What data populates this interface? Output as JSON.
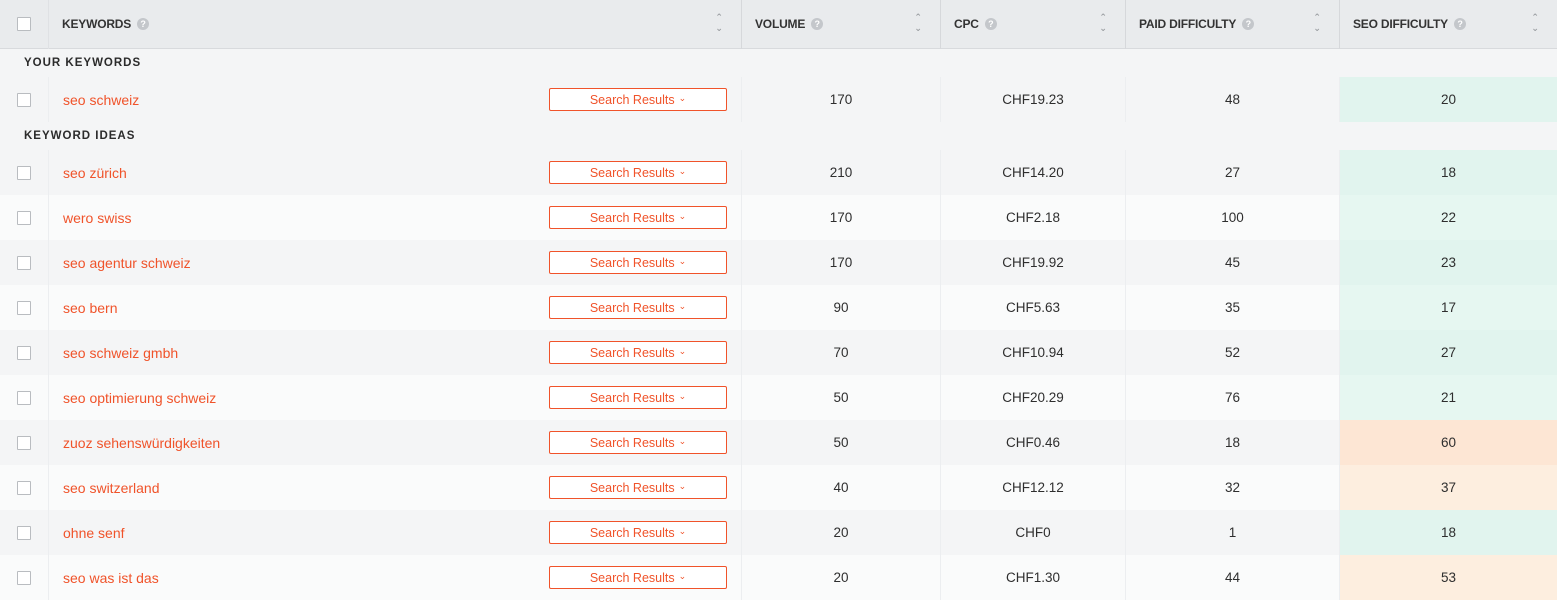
{
  "header": {
    "keywords": "KEYWORDS",
    "volume": "VOLUME",
    "cpc": "CPC",
    "paid_difficulty": "PAID DIFFICULTY",
    "seo_difficulty": "SEO DIFFICULTY",
    "help_glyph": "?",
    "sort_up": "⌃",
    "sort_down": "⌄"
  },
  "sections": {
    "your_keywords": "YOUR KEYWORDS",
    "keyword_ideas": "KEYWORD IDEAS"
  },
  "button_label": "Search Results",
  "colors": {
    "accent": "#f0532a",
    "seo_easy": "#e1f4ee",
    "seo_medium": "#fde6d4"
  },
  "your_keywords": [
    {
      "keyword": "seo schweiz",
      "volume": "170",
      "cpc": "CHF19.23",
      "paid": "48",
      "seo": "20",
      "seo_level": "easy"
    }
  ],
  "keyword_ideas": [
    {
      "keyword": "seo zürich",
      "volume": "210",
      "cpc": "CHF14.20",
      "paid": "27",
      "seo": "18",
      "seo_level": "easy"
    },
    {
      "keyword": "wero swiss",
      "volume": "170",
      "cpc": "CHF2.18",
      "paid": "100",
      "seo": "22",
      "seo_level": "easy"
    },
    {
      "keyword": "seo agentur schweiz",
      "volume": "170",
      "cpc": "CHF19.92",
      "paid": "45",
      "seo": "23",
      "seo_level": "easy"
    },
    {
      "keyword": "seo bern",
      "volume": "90",
      "cpc": "CHF5.63",
      "paid": "35",
      "seo": "17",
      "seo_level": "easy"
    },
    {
      "keyword": "seo schweiz gmbh",
      "volume": "70",
      "cpc": "CHF10.94",
      "paid": "52",
      "seo": "27",
      "seo_level": "easy"
    },
    {
      "keyword": "seo optimierung schweiz",
      "volume": "50",
      "cpc": "CHF20.29",
      "paid": "76",
      "seo": "21",
      "seo_level": "easy"
    },
    {
      "keyword": "zuoz sehenswürdigkeiten",
      "volume": "50",
      "cpc": "CHF0.46",
      "paid": "18",
      "seo": "60",
      "seo_level": "medium"
    },
    {
      "keyword": "seo switzerland",
      "volume": "40",
      "cpc": "CHF12.12",
      "paid": "32",
      "seo": "37",
      "seo_level": "medium"
    },
    {
      "keyword": "ohne senf",
      "volume": "20",
      "cpc": "CHF0",
      "paid": "1",
      "seo": "18",
      "seo_level": "easy"
    },
    {
      "keyword": "seo was ist das",
      "volume": "20",
      "cpc": "CHF1.30",
      "paid": "44",
      "seo": "53",
      "seo_level": "medium"
    }
  ]
}
